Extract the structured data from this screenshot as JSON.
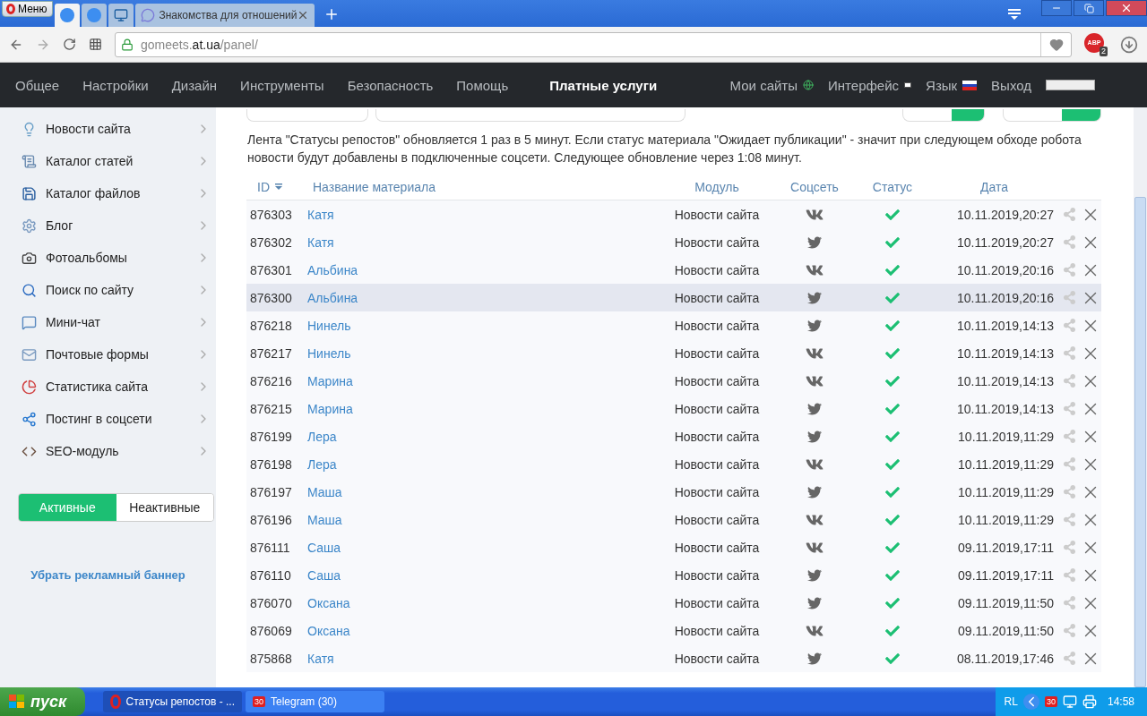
{
  "browser": {
    "menu_button": "Меню",
    "tabs": [
      {
        "kind": "ucoz",
        "selected": true
      },
      {
        "kind": "ucoz",
        "selected": false
      },
      {
        "kind": "monitor",
        "selected": false
      },
      {
        "kind": "chat",
        "title": "Знакомства для отношений",
        "selected": false
      }
    ],
    "address": "gomeets.**at.ua**/panel/",
    "adblock_label": "ABP",
    "adblock_count": "2"
  },
  "nav": {
    "items": [
      {
        "label": "Общее",
        "emphasized": false
      },
      {
        "label": "Настройки",
        "emphasized": false
      },
      {
        "label": "Дизайн",
        "emphasized": false
      },
      {
        "label": "Инструменты",
        "emphasized": false
      },
      {
        "label": "Безопасность",
        "emphasized": false
      },
      {
        "label": "Помощь",
        "emphasized": false
      },
      {
        "label": "Платные услуги",
        "emphasized": true
      }
    ],
    "right": [
      {
        "label": "Мои сайты",
        "kind": "globe"
      },
      {
        "label": "Интерфейс",
        "kind": "square"
      },
      {
        "label": "Язык",
        "kind": "flag"
      },
      {
        "label": "Выход",
        "kind": "none"
      }
    ]
  },
  "sidebar": {
    "items": [
      {
        "label": "Новости сайта",
        "kind": "bulb"
      },
      {
        "label": "Каталог статей",
        "kind": "scroll"
      },
      {
        "label": "Каталог файлов",
        "kind": "disk"
      },
      {
        "label": "Блог",
        "kind": "gear"
      },
      {
        "label": "Фотоальбомы",
        "kind": "camera"
      },
      {
        "label": "Поиск по сайту",
        "kind": "search"
      },
      {
        "label": "Мини-чат",
        "kind": "chat"
      },
      {
        "label": "Почтовые формы",
        "kind": "mail"
      },
      {
        "label": "Статистика сайта",
        "kind": "pie"
      },
      {
        "label": "Постинг в соцсети",
        "kind": "share"
      },
      {
        "label": "SEO-модуль",
        "kind": "seo"
      }
    ],
    "toggle": [
      {
        "label": "Активные",
        "selected": true
      },
      {
        "label": "Неактивные",
        "selected": false
      }
    ],
    "remove_banner_link": "Убрать рекламный баннер"
  },
  "notice": "Лента \"Статусы репостов\" обновляется 1 раз в 5 минут. Если статус материала \"Ожидает публикации\" - значит при следующем обходе робота новости будут добавлены в подключенные соцсети. Следующее обновление через 1:08 минут.",
  "table": {
    "columns": [
      "ID",
      "Название материала",
      "Модуль",
      "Соцсеть",
      "Статус",
      "Дата"
    ],
    "rows": [
      {
        "id": "876303",
        "title": "Катя",
        "module": "Новости сайта",
        "kind": "vk",
        "published": true,
        "date": "10.11.2019,20:27",
        "highlighted": false
      },
      {
        "id": "876302",
        "title": "Катя",
        "module": "Новости сайта",
        "kind": "twitter",
        "published": true,
        "date": "10.11.2019,20:27",
        "highlighted": false
      },
      {
        "id": "876301",
        "title": "Альбина",
        "module": "Новости сайта",
        "kind": "vk",
        "published": true,
        "date": "10.11.2019,20:16",
        "highlighted": false
      },
      {
        "id": "876300",
        "title": "Альбина",
        "module": "Новости сайта",
        "kind": "twitter",
        "published": true,
        "date": "10.11.2019,20:16",
        "highlighted": true
      },
      {
        "id": "876218",
        "title": "Нинель",
        "module": "Новости сайта",
        "kind": "twitter",
        "published": true,
        "date": "10.11.2019,14:13",
        "highlighted": false
      },
      {
        "id": "876217",
        "title": "Нинель",
        "module": "Новости сайта",
        "kind": "vk",
        "published": true,
        "date": "10.11.2019,14:13",
        "highlighted": false
      },
      {
        "id": "876216",
        "title": "Марина",
        "module": "Новости сайта",
        "kind": "vk",
        "published": true,
        "date": "10.11.2019,14:13",
        "highlighted": false
      },
      {
        "id": "876215",
        "title": "Марина",
        "module": "Новости сайта",
        "kind": "twitter",
        "published": true,
        "date": "10.11.2019,14:13",
        "highlighted": false
      },
      {
        "id": "876199",
        "title": "Лера",
        "module": "Новости сайта",
        "kind": "twitter",
        "published": true,
        "date": "10.11.2019,11:29",
        "highlighted": false
      },
      {
        "id": "876198",
        "title": "Лера",
        "module": "Новости сайта",
        "kind": "vk",
        "published": true,
        "date": "10.11.2019,11:29",
        "highlighted": false
      },
      {
        "id": "876197",
        "title": "Маша",
        "module": "Новости сайта",
        "kind": "twitter",
        "published": true,
        "date": "10.11.2019,11:29",
        "highlighted": false
      },
      {
        "id": "876196",
        "title": "Маша",
        "module": "Новости сайта",
        "kind": "vk",
        "published": true,
        "date": "10.11.2019,11:29",
        "highlighted": false
      },
      {
        "id": "876111",
        "title": "Саша",
        "module": "Новости сайта",
        "kind": "vk",
        "published": true,
        "date": "09.11.2019,17:11",
        "highlighted": false
      },
      {
        "id": "876110",
        "title": "Саша",
        "module": "Новости сайта",
        "kind": "twitter",
        "published": true,
        "date": "09.11.2019,17:11",
        "highlighted": false
      },
      {
        "id": "876070",
        "title": "Оксана",
        "module": "Новости сайта",
        "kind": "twitter",
        "published": true,
        "date": "09.11.2019,11:50",
        "highlighted": false
      },
      {
        "id": "876069",
        "title": "Оксана",
        "module": "Новости сайта",
        "kind": "vk",
        "published": true,
        "date": "09.11.2019,11:50",
        "highlighted": false
      },
      {
        "id": "875868",
        "title": "Катя",
        "module": "Новости сайта",
        "kind": "twitter",
        "published": true,
        "date": "08.11.2019,17:46",
        "highlighted": false
      }
    ]
  },
  "taskbar": {
    "start": "пуск",
    "tasks": [
      {
        "label": "Статусы репостов - ...",
        "kind": "opera",
        "selected": true
      },
      {
        "label": "Telegram (30)",
        "kind": "telegram",
        "badge": "30",
        "selected": false
      }
    ],
    "tray": {
      "language": "RL",
      "badge": "30",
      "clock": "14:58"
    }
  }
}
